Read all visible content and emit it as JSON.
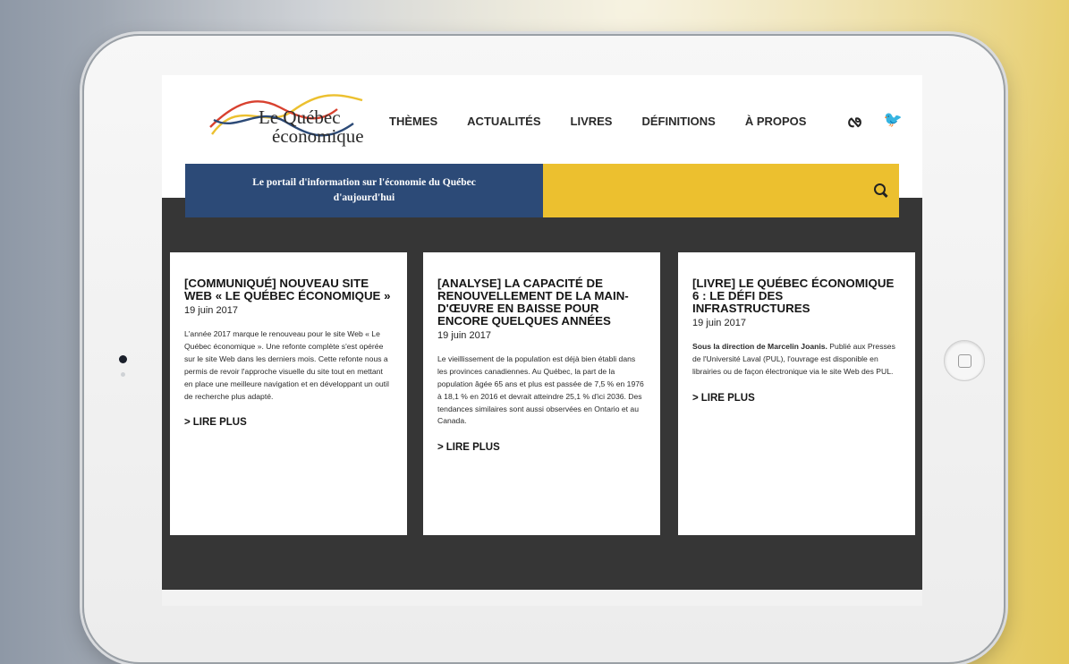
{
  "site": {
    "logo_line1": "Le Québec",
    "logo_line2": "économique",
    "nav": [
      {
        "label": "THÈMES"
      },
      {
        "label": "ACTUALITÉS"
      },
      {
        "label": "LIVRES"
      },
      {
        "label": "DÉFINITIONS"
      },
      {
        "label": "À PROPOS"
      }
    ],
    "social": {
      "rss_icon": "rss-icon",
      "twitter_icon": "twitter-icon"
    },
    "tagline": "Le portail d'information sur l'économie du Québec d'aujourd'hui",
    "search_icon": "search-icon",
    "colors": {
      "blue": "#2c4a77",
      "yellow": "#ecc02f",
      "dark": "#363636",
      "red": "#d8412f"
    }
  },
  "cards": [
    {
      "title": "[COMMUNIQUÉ] NOUVEAU SITE WEB « LE QUÉBEC ÉCONOMIQUE »",
      "date": "19 juin 2017",
      "body_bold": "",
      "body": "L'année 2017 marque le renouveau pour le site Web « Le Québec économique ». Une refonte complète s'est opérée sur le site Web dans les derniers mois. Cette refonte nous a permis de revoir l'approche visuelle du site tout en mettant en place une meilleure navigation et en développant un outil de recherche plus adapté.",
      "more": "LIRE PLUS"
    },
    {
      "title": "[ANALYSE] LA CAPACITÉ DE RENOUVELLEMENT DE LA MAIN-D'ŒUVRE EN BAISSE POUR ENCORE QUELQUES ANNÉES",
      "date": "19 juin 2017",
      "body_bold": "",
      "body": "Le vieillissement de la population est déjà bien établi dans les provinces canadiennes. Au Québec, la part de la population âgée 65 ans et plus est passée de 7,5 % en 1976 à 18,1 % en 2016 et devrait atteindre 25,1 % d'ici 2036. Des tendances similaires sont aussi observées en Ontario et au Canada.",
      "more": "LIRE PLUS"
    },
    {
      "title": "[LIVRE] LE QUÉBEC ÉCONOMIQUE 6 : LE DÉFI DES INFRASTRUCTURES",
      "date": "19 juin 2017",
      "body_bold": "Sous la direction de Marcelin Joanis.",
      "body": " Publié aux Presses de l'Université Laval (PUL), l'ouvrage est disponible en librairies ou de façon électronique via le site Web des PUL.",
      "more": "LIRE PLUS"
    }
  ]
}
